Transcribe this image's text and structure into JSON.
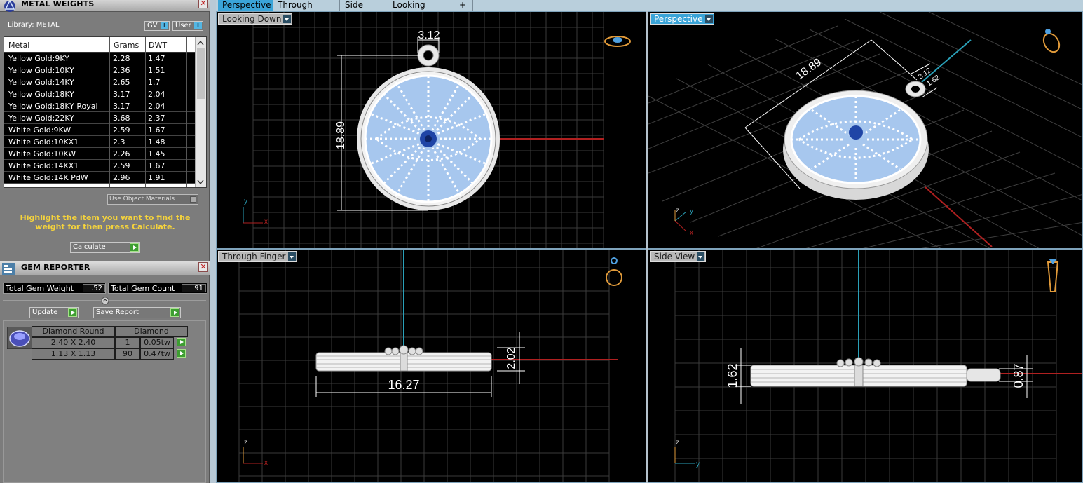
{
  "metal_panel": {
    "title": "METAL WEIGHTS",
    "library": "Library: METAL",
    "toggle_gv": "GV",
    "toggle_user": "User",
    "columns": [
      "Metal",
      "Grams",
      "DWT"
    ],
    "rows": [
      [
        "Yellow Gold:9KY",
        "2.28",
        "1.47"
      ],
      [
        "Yellow Gold:10KY",
        "2.36",
        "1.51"
      ],
      [
        "Yellow Gold:14KY",
        "2.65",
        "1.7"
      ],
      [
        "Yellow Gold:18KY",
        "3.17",
        "2.04"
      ],
      [
        "Yellow Gold:18KY Royal",
        "3.17",
        "2.04"
      ],
      [
        "Yellow Gold:22KY",
        "3.68",
        "2.37"
      ],
      [
        "White Gold:9KW",
        "2.59",
        "1.67"
      ],
      [
        "White Gold:10KX1",
        "2.3",
        "1.48"
      ],
      [
        "White Gold:10KW",
        "2.26",
        "1.45"
      ],
      [
        "White Gold:14KX1",
        "2.59",
        "1.67"
      ],
      [
        "White Gold:14K PdW",
        "2.96",
        "1.91"
      ]
    ],
    "use_object_materials": "Use Object Materials",
    "hint": "Highlight the item you want to find the weight for then press Calculate.",
    "calculate": "Calculate"
  },
  "gem_panel": {
    "title": "GEM REPORTER",
    "total_weight_label": "Total Gem Weight",
    "total_weight_value": ".52",
    "total_count_label": "Total Gem Count",
    "total_count_value": "91",
    "update": "Update",
    "save_report": "Save Report",
    "shape_header": "Diamond Round",
    "type_header": "Diamond",
    "rows": [
      [
        "2.40 X 2.40",
        "1",
        "0.05tw"
      ],
      [
        "1.13 X 1.13",
        "90",
        "0.47tw"
      ]
    ]
  },
  "tabs": [
    "Perspective",
    "Through Finger",
    "Side View",
    "Looking Down",
    "+"
  ],
  "viewports": {
    "looking_down": {
      "label": "Looking Down",
      "dim_width": "3.12",
      "dim_height": "18.89"
    },
    "perspective": {
      "label": "Perspective",
      "dim_diag": "18.89",
      "dim_small_a": "3.12",
      "dim_small_b": "1.62"
    },
    "through_finger": {
      "label": "Through Finger",
      "dim_width": "16.27",
      "dim_height": "2.02"
    },
    "side_view": {
      "label": "Side View",
      "dim_left": "1.62",
      "dim_right": "0.87"
    }
  },
  "axes": {
    "x": "x",
    "y": "y",
    "z": "z"
  },
  "colors": {
    "accent": "#3aa4d8",
    "hint": "#f5d33c",
    "gem_blue": "#a7c7ee",
    "axis_red": "#b02020",
    "axis_cyan": "#2aa0b8"
  }
}
